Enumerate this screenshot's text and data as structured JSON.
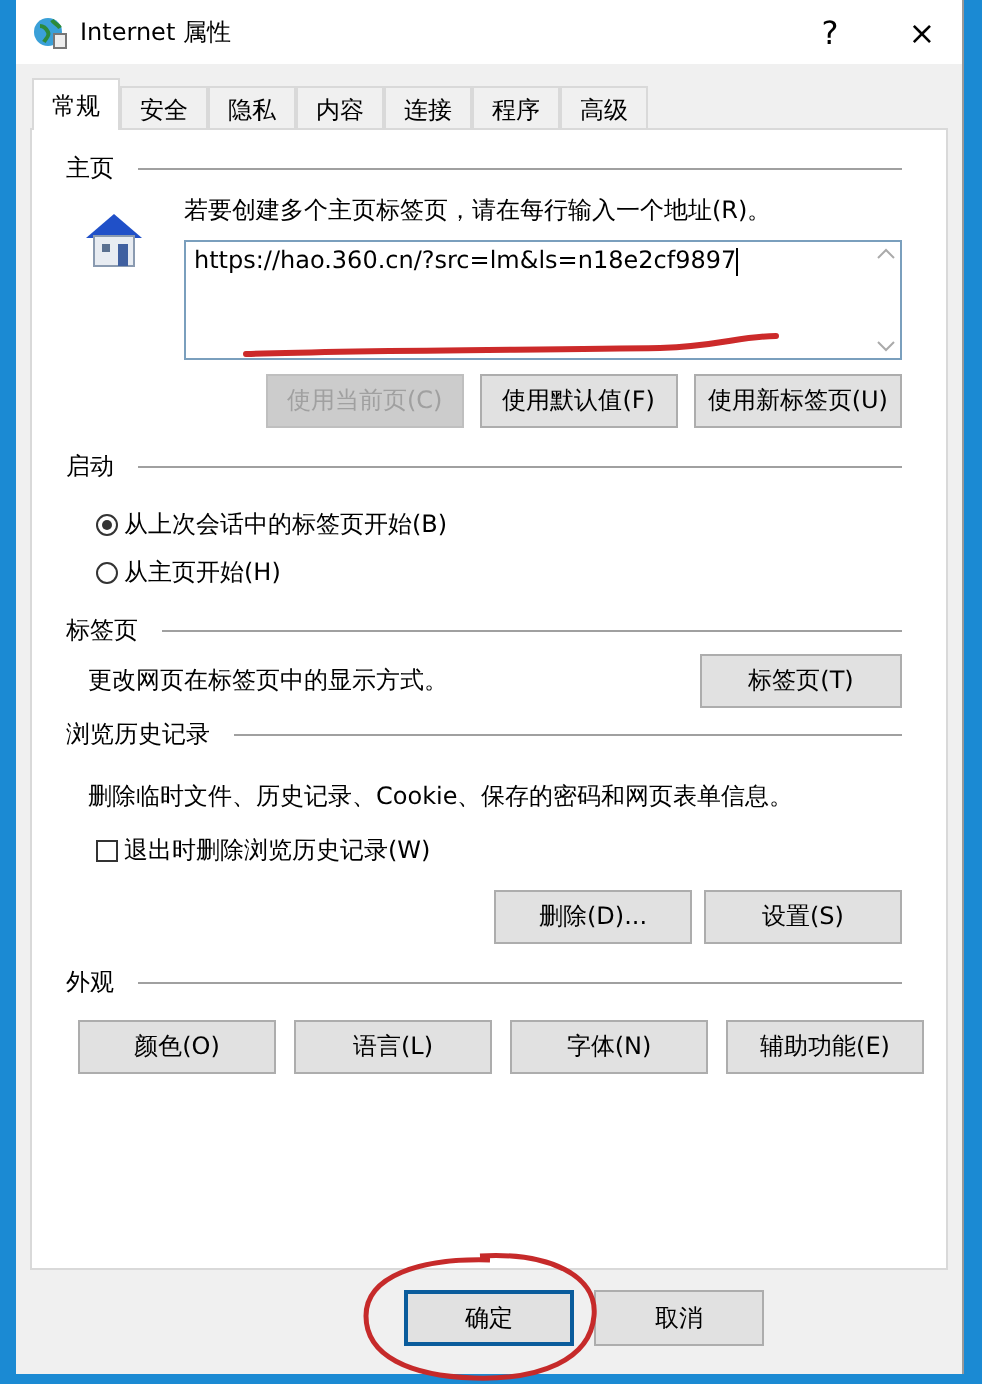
{
  "window": {
    "title": "Internet 属性",
    "help": "?",
    "close": "×"
  },
  "tabs": [
    {
      "label": "常规",
      "selected": true
    },
    {
      "label": "安全",
      "selected": false
    },
    {
      "label": "隐私",
      "selected": false
    },
    {
      "label": "内容",
      "selected": false
    },
    {
      "label": "连接",
      "selected": false
    },
    {
      "label": "程序",
      "selected": false
    },
    {
      "label": "高级",
      "selected": false
    }
  ],
  "home": {
    "heading": "主页",
    "instruction": "若要创建多个主页标签页，请在每行输入一个地址(R)。",
    "value": "https://hao.360.cn/?src=lm&ls=n18e2cf9897",
    "buttons": [
      {
        "label": "使用当前页(C)",
        "disabled": true
      },
      {
        "label": "使用默认值(F)",
        "disabled": false
      },
      {
        "label": "使用新标签页(U)",
        "disabled": false
      }
    ]
  },
  "startup": {
    "heading": "启动",
    "options": [
      {
        "label": "从上次会话中的标签页开始(B)",
        "selected": true
      },
      {
        "label": "从主页开始(H)",
        "selected": false
      }
    ]
  },
  "tabs_section": {
    "heading": "标签页",
    "description": "更改网页在标签页中的显示方式。",
    "button": "标签页(T)"
  },
  "history": {
    "heading": "浏览历史记录",
    "description": "删除临时文件、历史记录、Cookie、保存的密码和网页表单信息。",
    "checkbox": {
      "label": "退出时删除浏览历史记录(W)",
      "checked": false
    },
    "buttons": [
      "删除(D)...",
      "设置(S)"
    ]
  },
  "appearance": {
    "heading": "外观",
    "buttons": [
      "颜色(O)",
      "语言(L)",
      "字体(N)",
      "辅助功能(E)"
    ]
  },
  "footer": {
    "buttons": [
      {
        "label": "确定",
        "default": true
      },
      {
        "label": "取消",
        "default": false
      }
    ]
  },
  "annotations": [
    {
      "kind": "underline"
    },
    {
      "kind": "circle"
    }
  ]
}
